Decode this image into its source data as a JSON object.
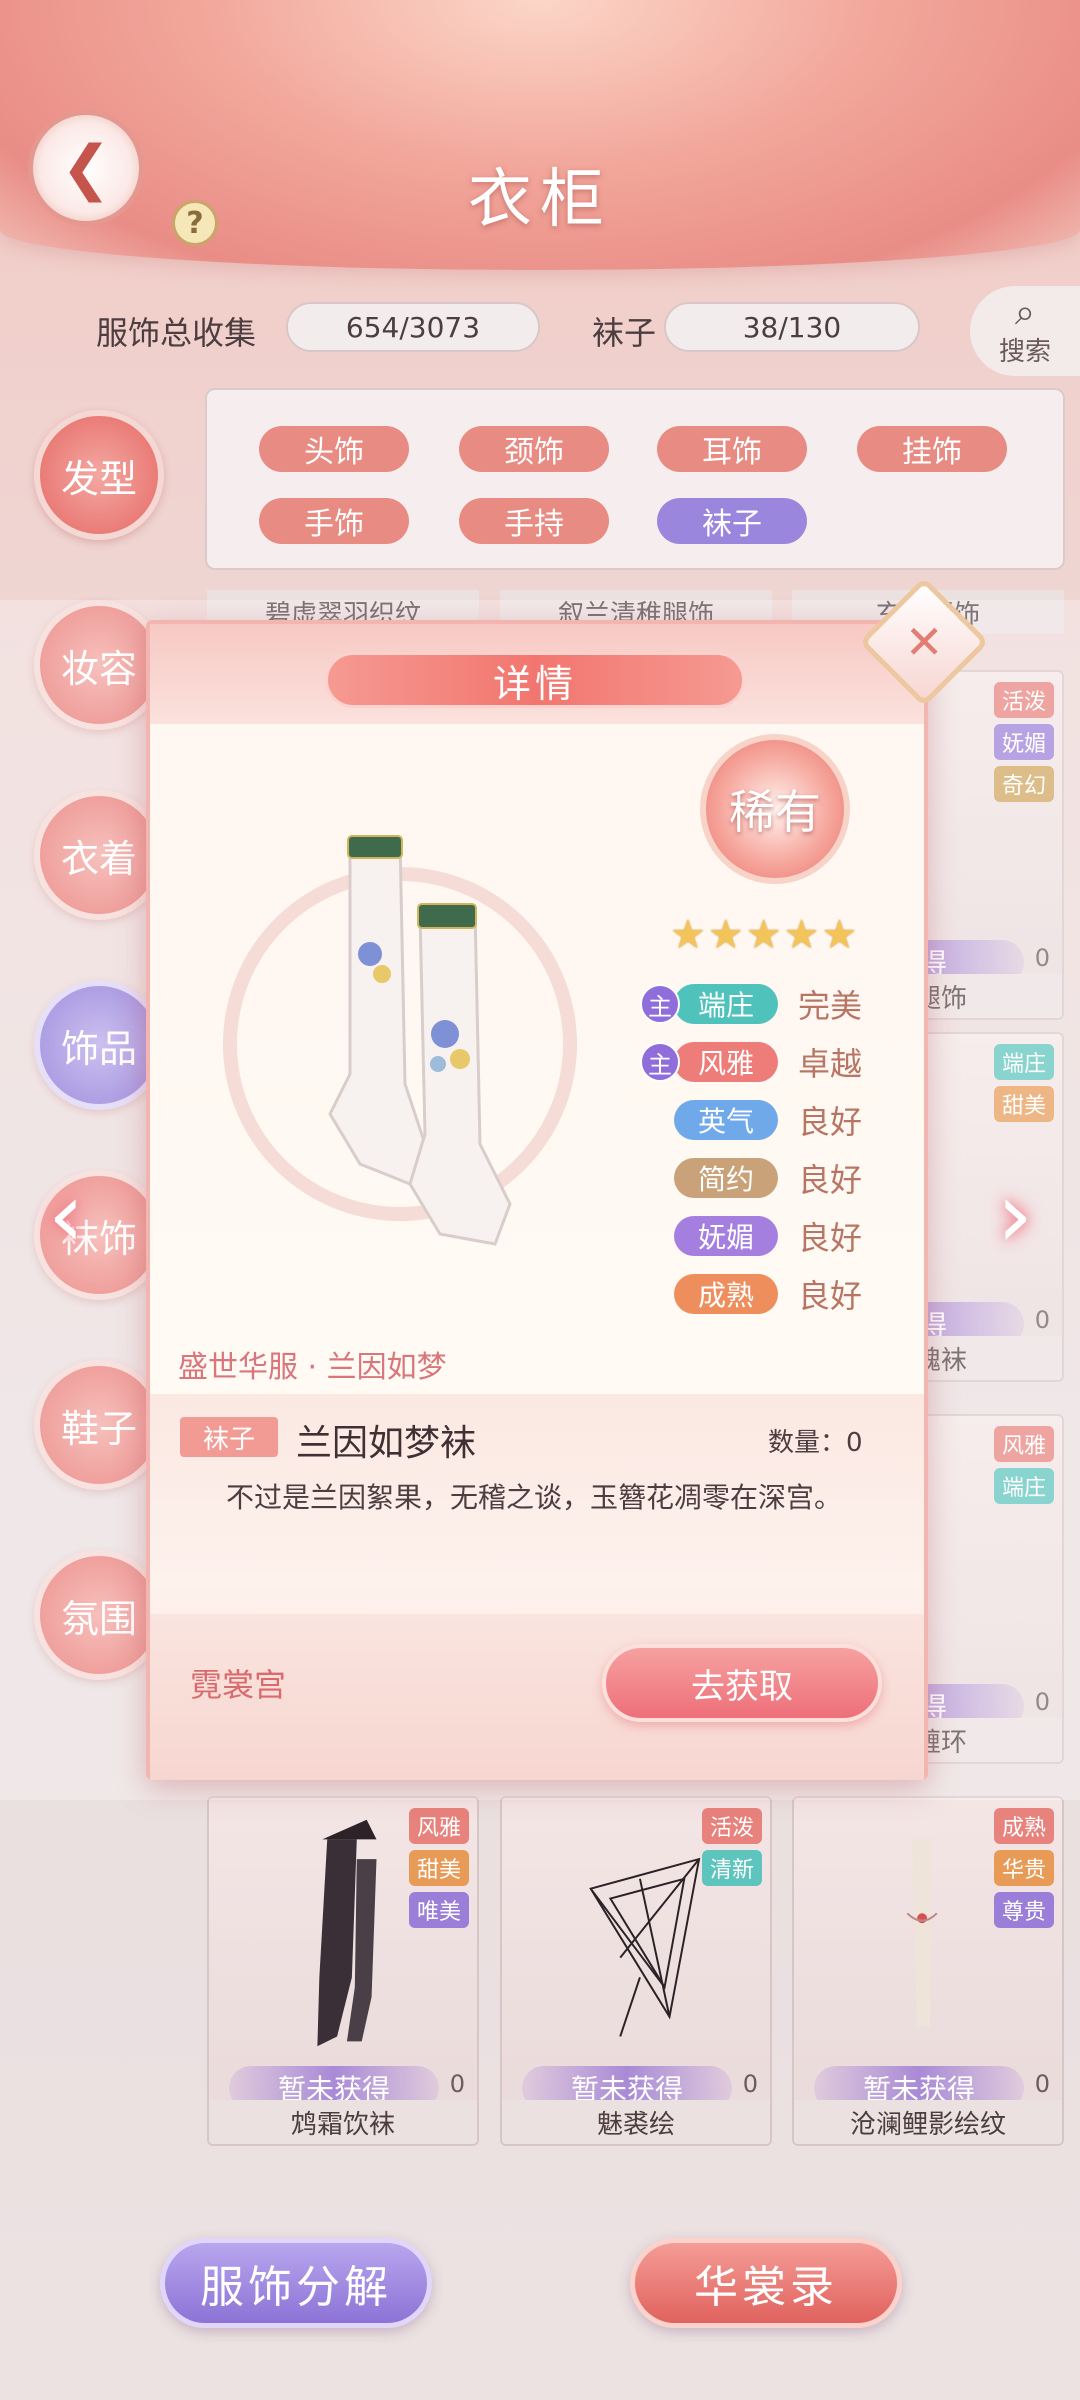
{
  "header": {
    "title": "衣柜"
  },
  "stats": {
    "total_label": "服饰总收集",
    "total_value": "654/3073",
    "category_label": "袜子",
    "category_value": "38/130",
    "search_label": "搜索"
  },
  "nav": [
    "发型",
    "妆容",
    "衣着",
    "饰品",
    "袜饰",
    "鞋子",
    "氛围"
  ],
  "filters": [
    "头饰",
    "颈饰",
    "耳饰",
    "挂饰",
    "手饰",
    "手持",
    "袜子"
  ],
  "grid_top_names": [
    "碧虚翠羽织纹",
    "叙兰清稚腿饰",
    "玄鸢腿饰"
  ],
  "grid_right": [
    {
      "tags": [
        "活泼",
        "妩媚",
        "奇幻"
      ],
      "status": "获得",
      "count": "0",
      "name": "泽腿饰"
    },
    {
      "tags": [
        "端庄",
        "甜美"
      ],
      "status": "获得",
      "count": "0",
      "name": "织魂袜"
    },
    {
      "tags": [
        "风雅",
        "端庄"
      ],
      "status": "获得",
      "count": "0",
      "name": "影缠环"
    }
  ],
  "grid_bottom": [
    {
      "tags": [
        "风雅",
        "甜美",
        "唯美"
      ],
      "status": "暂未获得",
      "count": "0",
      "name": "鸩霜饮袜"
    },
    {
      "tags": [
        "活泼",
        "清新"
      ],
      "status": "暂未获得",
      "count": "0",
      "name": "魅裘绘"
    },
    {
      "tags": [
        "成熟",
        "华贵",
        "尊贵"
      ],
      "status": "暂未获得",
      "count": "0",
      "name": "沧澜鲤影绘纹"
    }
  ],
  "modal": {
    "title": "详情",
    "rarity": "稀有",
    "stars": "★★★★★",
    "main_marker": "主",
    "attributes": [
      {
        "name": "端庄",
        "value": "完美",
        "main": true,
        "color": "#4fc2bb"
      },
      {
        "name": "风雅",
        "value": "卓越",
        "main": true,
        "color": "#ee7d79"
      },
      {
        "name": "英气",
        "value": "良好",
        "main": false,
        "color": "#6fa9ea"
      },
      {
        "name": "简约",
        "value": "良好",
        "main": false,
        "color": "#c9a27a"
      },
      {
        "name": "妩媚",
        "value": "良好",
        "main": false,
        "color": "#a57fe0"
      },
      {
        "name": "成熟",
        "value": "良好",
        "main": false,
        "color": "#ef8e5d"
      }
    ],
    "series": "盛世华服 · 兰因如梦",
    "item_type": "袜子",
    "item_name": "兰因如梦袜",
    "quantity": "数量：0",
    "description": "不过是兰因絮果，无稽之谈，玉簪花凋零在深宫。",
    "source": "霓裳宫",
    "get_button": "去获取"
  },
  "bottom": {
    "decompose": "服饰分解",
    "album": "华裳录"
  }
}
